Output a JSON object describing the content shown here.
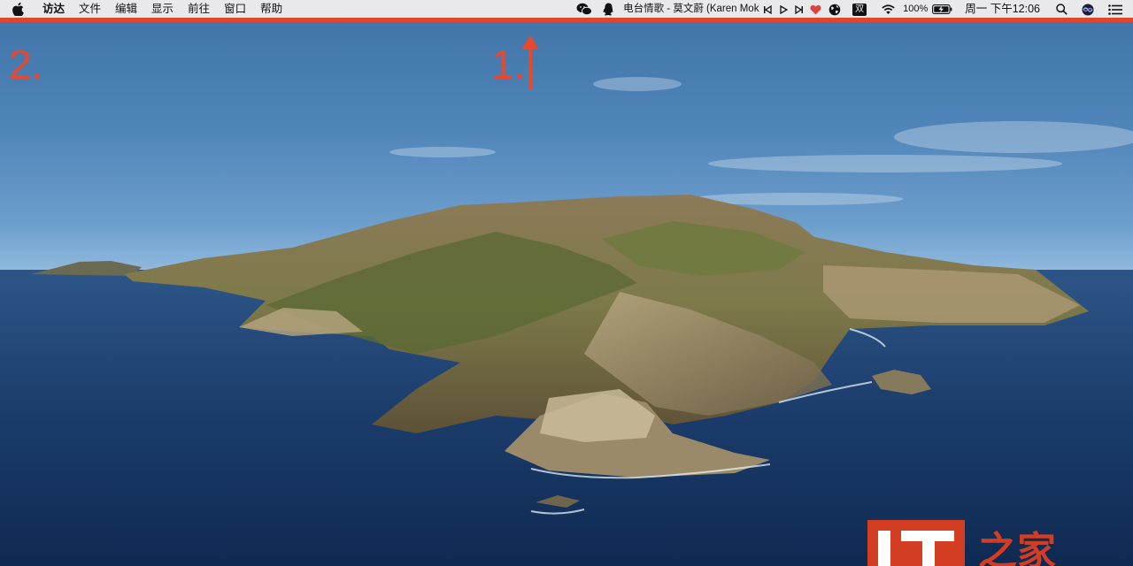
{
  "menubar": {
    "apple_icon": "apple-logo-icon",
    "items": [
      "访达",
      "文件",
      "编辑",
      "显示",
      "前往",
      "窗口",
      "帮助"
    ],
    "status": {
      "wechat_icon": "wechat-icon",
      "qq_icon": "qq-penguin-icon",
      "now_playing": "电台情歌 - 莫文蔚 (Karen Mok)",
      "prev_icon": "previous-track-icon",
      "play_icon": "play-icon",
      "next_icon": "next-track-icon",
      "heart_icon": "heart-icon",
      "heart_color": "#d9463f",
      "globe_icon": "globe-icon",
      "input_method": "双",
      "wifi_icon": "wifi-icon",
      "battery_percent": "100%",
      "battery_icon": "battery-charging-icon",
      "clock": "周一 下午12:06",
      "search_icon": "spotlight-search-icon",
      "siri_icon": "siri-icon",
      "list_icon": "notification-center-icon"
    }
  },
  "annotations": {
    "label_1": "1.",
    "label_2": "2.",
    "accent_color": "#e2452a"
  },
  "watermark": {
    "logo": "IT",
    "text": "之家"
  }
}
